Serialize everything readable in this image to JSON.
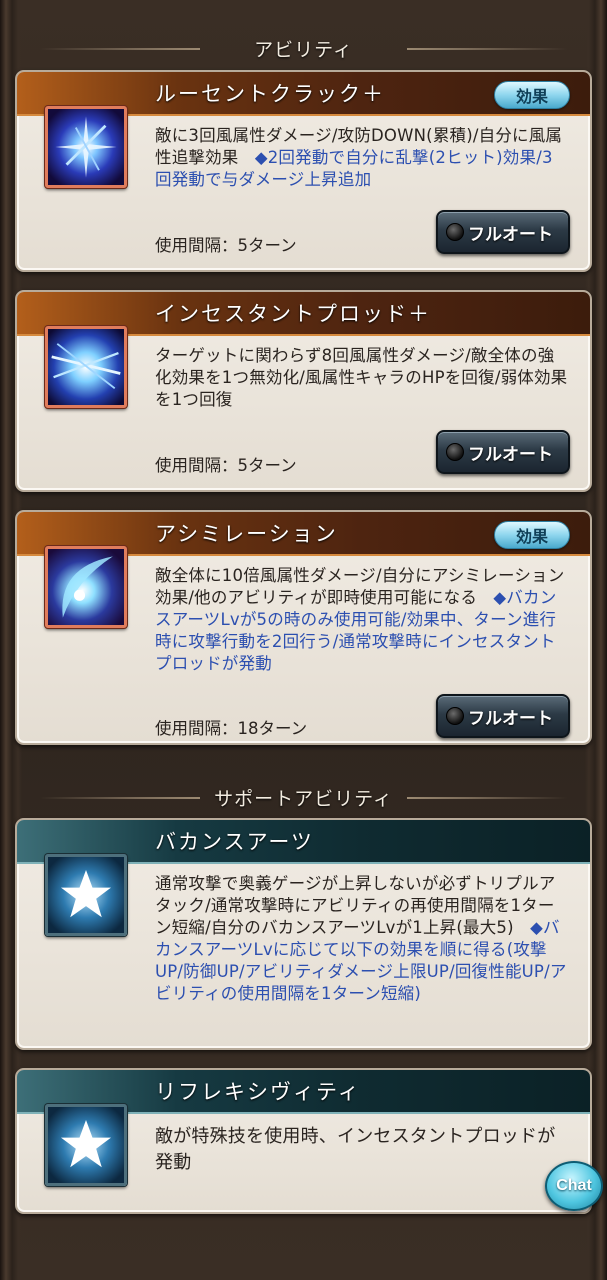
{
  "sections": {
    "abilities_title": "アビリティ",
    "support_title": "サポートアビリティ"
  },
  "abilities": [
    {
      "name": "ルーセントクラック＋",
      "has_effect_badge": true,
      "desc_plain": "敵に3回風属性ダメージ/攻防DOWN(累積)/自分に風属性追撃効果",
      "desc_blue": "◆2回発動で自分に乱撃(2ヒット)効果/3回発動で与ダメージ上昇追加",
      "interval": "使用間隔：5ターン",
      "auto_label": "フルオート"
    },
    {
      "name": "インセスタントプロッド＋",
      "has_effect_badge": false,
      "desc_plain": "ターゲットに関わらず8回風属性ダメージ/敵全体の強化効果を1つ無効化/風属性キャラのHPを回復/弱体効果を1つ回復",
      "desc_blue": "",
      "interval": "使用間隔：5ターン",
      "auto_label": "フルオート"
    },
    {
      "name": "アシミレーション",
      "has_effect_badge": true,
      "desc_plain": "敵全体に10倍風属性ダメージ/自分にアシミレーション効果/他のアビリティが即時使用可能になる",
      "desc_blue": "◆バカンスアーツLvが5の時のみ使用可能/効果中、ターン進行時に攻撃行動を2回行う/通常攻撃時にインセスタントプロッドが発動",
      "interval": "使用間隔：18ターン",
      "auto_label": "フルオート"
    }
  ],
  "effect_badge_label": "効果",
  "support": [
    {
      "name": "バカンスアーツ",
      "desc_plain": "通常攻撃で奥義ゲージが上昇しないが必ずトリプルアタック/通常攻撃時にアビリティの再使用間隔を1ターン短縮/自分のバカンスアーツLvが1上昇(最大5)",
      "desc_blue": "◆バカンスアーツLvに応じて以下の効果を順に得る(攻撃UP/防御UP/アビリティダメージ上限UP/回復性能UP/アビリティの使用間隔を1ターン短縮)"
    },
    {
      "name": "リフレキシヴィティ",
      "desc_plain": "敵が特殊技を使用時、インセスタントプロッドが発動",
      "desc_blue": ""
    }
  ],
  "chat_label": "Chat",
  "colors": {
    "ability_bar": "#6a3310",
    "support_bar": "#163a42",
    "blue_text": "#2c4fb0",
    "card_bg": "#f1ece4"
  }
}
